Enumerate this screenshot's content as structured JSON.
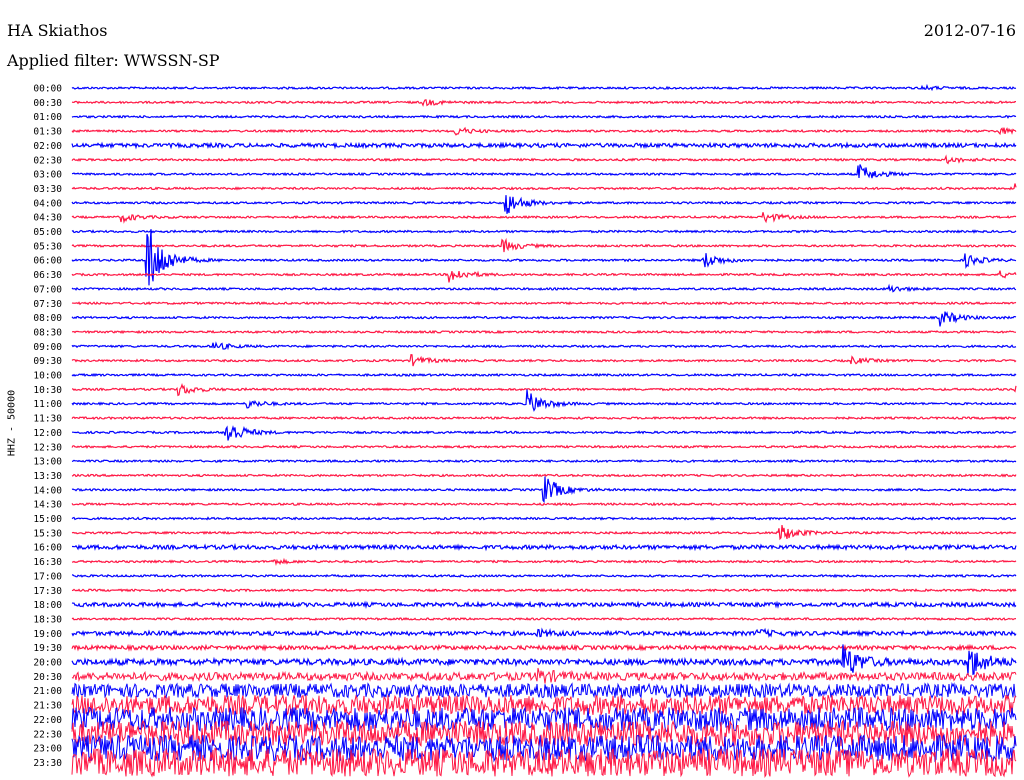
{
  "header": {
    "station": "HA Skiathos",
    "date": "2012-07-16",
    "filter": "Applied filter: WWSSN-SP"
  },
  "channel_label": "HHZ - 50000",
  "colors": {
    "even_trace": "#0000ff",
    "odd_trace": "#ff1744"
  },
  "chart_data": {
    "type": "line",
    "title": "HA Skiathos",
    "subtitle": "Applied filter: WWSSN-SP",
    "ylabel": "HHZ - 50000",
    "xlabel": "",
    "grid": false,
    "legend": "none",
    "x_range_minutes": [
      0,
      30
    ],
    "trace_labels": [
      "00:00",
      "00:30",
      "01:00",
      "01:30",
      "02:00",
      "02:30",
      "03:00",
      "03:30",
      "04:00",
      "04:30",
      "05:00",
      "05:30",
      "06:00",
      "06:30",
      "07:00",
      "07:30",
      "08:00",
      "08:30",
      "09:00",
      "09:30",
      "10:00",
      "10:30",
      "11:00",
      "11:30",
      "12:00",
      "12:30",
      "13:00",
      "13:30",
      "14:00",
      "14:30",
      "15:00",
      "15:30",
      "16:00",
      "16:30",
      "17:00",
      "17:30",
      "18:00",
      "18:30",
      "19:00",
      "19:30",
      "20:00",
      "20:30",
      "21:00",
      "21:30",
      "22:00",
      "22:30",
      "23:00",
      "23:30"
    ],
    "noise_level": [
      1,
      1,
      1,
      1,
      2,
      1,
      1,
      1,
      1,
      1,
      1,
      1,
      1,
      1,
      1,
      1,
      1,
      1,
      1,
      1,
      1,
      1,
      1,
      1,
      1,
      1,
      1,
      1,
      1,
      1,
      1,
      1,
      2,
      1,
      1,
      1,
      2,
      1,
      2,
      2,
      3,
      4,
      7,
      10,
      12,
      13,
      13,
      14
    ],
    "events": [
      {
        "trace": 0,
        "minute": 27.0,
        "amp": 2
      },
      {
        "trace": 1,
        "minute": 11.2,
        "amp": 3
      },
      {
        "trace": 3,
        "minute": 12.2,
        "amp": 4
      },
      {
        "trace": 3,
        "minute": 29.5,
        "amp": 3
      },
      {
        "trace": 5,
        "minute": 27.8,
        "amp": 3
      },
      {
        "trace": 6,
        "minute": 25.0,
        "amp": 10
      },
      {
        "trace": 7,
        "minute": 30.0,
        "amp": 4
      },
      {
        "trace": 8,
        "minute": 13.8,
        "amp": 12
      },
      {
        "trace": 9,
        "minute": 1.6,
        "amp": 4
      },
      {
        "trace": 9,
        "minute": 22.0,
        "amp": 5
      },
      {
        "trace": 11,
        "minute": 13.7,
        "amp": 6
      },
      {
        "trace": 12,
        "minute": 2.4,
        "amp": 40
      },
      {
        "trace": 12,
        "minute": 20.1,
        "amp": 8
      },
      {
        "trace": 12,
        "minute": 28.4,
        "amp": 6
      },
      {
        "trace": 13,
        "minute": 12.0,
        "amp": 8
      },
      {
        "trace": 13,
        "minute": 29.5,
        "amp": 3
      },
      {
        "trace": 14,
        "minute": 26.0,
        "amp": 3
      },
      {
        "trace": 16,
        "minute": 27.6,
        "amp": 8
      },
      {
        "trace": 18,
        "minute": 4.5,
        "amp": 4
      },
      {
        "trace": 19,
        "minute": 10.8,
        "amp": 5
      },
      {
        "trace": 19,
        "minute": 24.8,
        "amp": 3
      },
      {
        "trace": 21,
        "minute": 3.4,
        "amp": 6
      },
      {
        "trace": 21,
        "minute": 30.0,
        "amp": 10
      },
      {
        "trace": 22,
        "minute": 5.6,
        "amp": 4
      },
      {
        "trace": 22,
        "minute": 14.5,
        "amp": 12
      },
      {
        "trace": 24,
        "minute": 4.9,
        "amp": 14
      },
      {
        "trace": 28,
        "minute": 15.0,
        "amp": 14
      },
      {
        "trace": 31,
        "minute": 22.5,
        "amp": 9
      },
      {
        "trace": 33,
        "minute": 6.4,
        "amp": 2
      },
      {
        "trace": 38,
        "minute": 14.8,
        "amp": 3
      },
      {
        "trace": 38,
        "minute": 21.8,
        "amp": 3
      },
      {
        "trace": 40,
        "minute": 24.5,
        "amp": 18
      },
      {
        "trace": 40,
        "minute": 28.5,
        "amp": 16
      },
      {
        "trace": 41,
        "minute": 14.8,
        "amp": 6
      }
    ]
  }
}
